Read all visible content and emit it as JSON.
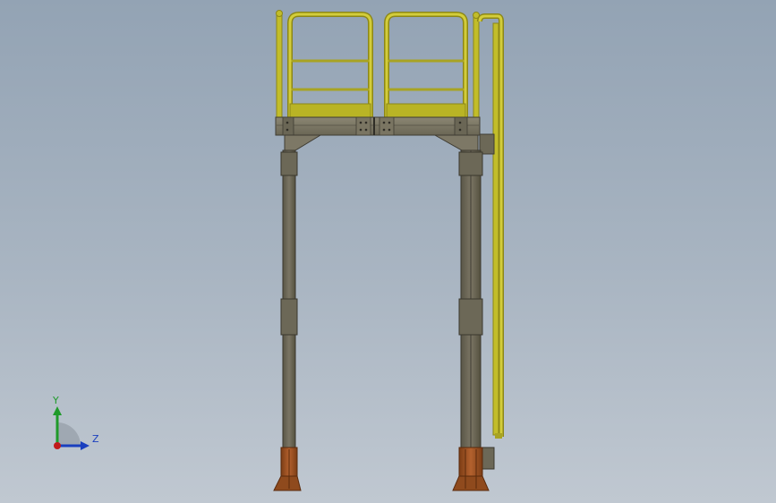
{
  "colors": {
    "background_top": "#93a3b4",
    "background_bottom": "#c0c8d1",
    "steel": "#75705f",
    "steel_dark": "#4f4b40",
    "steel_light": "#8e8876",
    "railing_yellow": "#c2bd2a",
    "railing_yellow_dark": "#8c8716",
    "base_plate": "#a05324",
    "base_plate_dark": "#6e3510",
    "axis_y": "#1f9a2a",
    "axis_z": "#1a3fbf",
    "axis_x": "#c11a1a"
  },
  "triad": {
    "y_label": "Y",
    "z_label": "Z",
    "icons": [
      "y-axis-arrow-icon",
      "z-axis-arrow-icon",
      "x-axis-origin-icon"
    ]
  }
}
